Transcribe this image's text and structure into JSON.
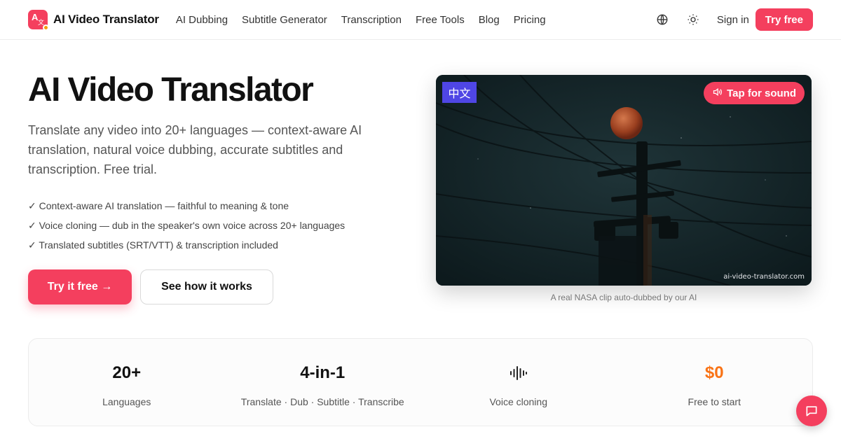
{
  "nav": {
    "brand": "AI Video Translator",
    "links": [
      "AI Dubbing",
      "Subtitle Generator",
      "Transcription",
      "Free Tools",
      "Blog",
      "Pricing"
    ],
    "sign_in": "Sign in",
    "try_free": "Try free",
    "icons": [
      "globe-icon",
      "sun-icon"
    ]
  },
  "hero": {
    "title": "AI Video Translator",
    "description": "Translate any video into 20+ languages — context-aware AI translation, natural voice dubbing, accurate subtitles and transcription. Free trial.",
    "features": [
      "✓ Context-aware AI translation — faithful to meaning & tone",
      "✓ Voice cloning — dub in the speaker's own voice across 20+ languages",
      "✓ Translated subtitles (SRT/VTT) & transcription included"
    ],
    "primary_cta": "Try it free →",
    "secondary_cta": "See how it works"
  },
  "video": {
    "language_badge": "中文",
    "sound_button": "Tap for sound",
    "watermark": "ai-video-translator.com",
    "caption": "A real NASA clip auto-dubbed by our AI"
  },
  "stats": [
    {
      "value": "20+",
      "label": "Languages"
    },
    {
      "value": "4-in-1",
      "label": "Translate · Dub · Subtitle · Transcribe"
    },
    {
      "value": "",
      "label": "Voice cloning",
      "icon": "audio-wave-icon"
    },
    {
      "value": "$0",
      "label": "Free to start"
    }
  ],
  "colors": {
    "accent": "#f43f5e",
    "badge": "#4f46e5",
    "price": "#f97316"
  }
}
